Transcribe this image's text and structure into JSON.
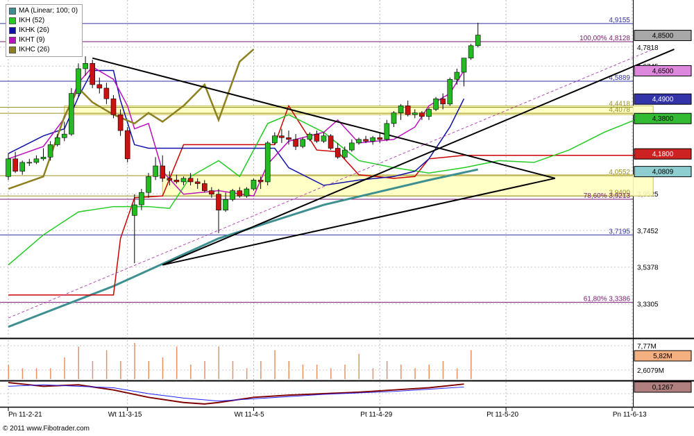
{
  "legend": [
    {
      "label": "MA (Linear; 100; 0)",
      "color": "#3d8f90"
    },
    {
      "label": "IKH (52)",
      "color": "#22cc22"
    },
    {
      "label": "IKHK (26)",
      "color": "#1010aa"
    },
    {
      "label": "IKHT (9)",
      "color": "#bb10bb"
    },
    {
      "label": "IKHC (26)",
      "color": "#8c8020"
    }
  ],
  "copyright": "© 2011 www.Fibotrader.com",
  "chart_data": [
    {
      "type": "candlestick",
      "title": "",
      "xlabel": "",
      "ylabel": "",
      "x_tick_labels": [
        "Pn 11-2-21",
        "Wt 11-3-15",
        "Wt 11-4-5",
        "Pt 11-4-29",
        "Pt 11-5-20",
        "Pn 11-6-13"
      ],
      "y_tick_labels": [
        "4,7818",
        "4,6745",
        "3,9525",
        "3,7452",
        "3,5378",
        "3,3305"
      ],
      "ylim": [
        3.14,
        4.97
      ],
      "grid": true,
      "candles": [
        [
          4.05,
          4.18,
          4.03,
          4.15
        ],
        [
          4.15,
          4.19,
          4.07,
          4.08
        ],
        [
          4.08,
          4.14,
          4.06,
          4.13
        ],
        [
          4.13,
          4.15,
          4.11,
          4.13
        ],
        [
          4.13,
          4.17,
          4.12,
          4.15
        ],
        [
          4.15,
          4.21,
          4.14,
          4.16
        ],
        [
          4.16,
          4.25,
          4.14,
          4.23
        ],
        [
          4.23,
          4.29,
          4.22,
          4.27
        ],
        [
          4.27,
          4.36,
          4.25,
          4.29
        ],
        [
          4.29,
          4.55,
          4.28,
          4.52
        ],
        [
          4.52,
          4.69,
          4.5,
          4.66
        ],
        [
          4.66,
          4.73,
          4.62,
          4.69
        ],
        [
          4.69,
          4.71,
          4.55,
          4.57
        ],
        [
          4.57,
          4.61,
          4.52,
          4.55
        ],
        [
          4.55,
          4.58,
          4.46,
          4.49
        ],
        [
          4.49,
          4.51,
          4.38,
          4.4
        ],
        [
          4.4,
          4.43,
          4.28,
          4.31
        ],
        [
          4.31,
          4.33,
          4.13,
          4.15
        ],
        [
          3.83,
          3.95,
          3.56,
          3.89
        ],
        [
          3.89,
          3.98,
          3.86,
          3.96
        ],
        [
          3.96,
          4.07,
          3.93,
          4.05
        ],
        [
          4.05,
          4.16,
          4.03,
          4.11
        ],
        [
          4.11,
          4.17,
          4.02,
          4.04
        ],
        [
          4.04,
          4.08,
          4.0,
          4.03
        ],
        [
          4.03,
          4.06,
          4.01,
          4.02
        ],
        [
          4.02,
          4.05,
          4.0,
          4.04
        ],
        [
          4.04,
          4.07,
          4.0,
          4.02
        ],
        [
          4.02,
          4.04,
          3.98,
          4.01
        ],
        [
          4.01,
          4.03,
          3.96,
          3.97
        ],
        [
          3.97,
          3.99,
          3.93,
          3.95
        ],
        [
          3.95,
          3.98,
          3.73,
          3.86
        ],
        [
          3.86,
          3.96,
          3.85,
          3.92
        ],
        [
          3.92,
          3.98,
          3.91,
          3.97
        ],
        [
          3.97,
          3.99,
          3.93,
          3.94
        ],
        [
          3.94,
          3.99,
          3.93,
          3.98
        ],
        [
          3.98,
          4.04,
          3.97,
          4.03
        ],
        [
          4.03,
          4.05,
          3.98,
          4.02
        ],
        [
          4.02,
          4.25,
          4.0,
          4.24
        ],
        [
          4.24,
          4.3,
          4.23,
          4.28
        ],
        [
          4.28,
          4.32,
          4.24,
          4.27
        ],
        [
          4.27,
          4.31,
          4.23,
          4.26
        ],
        [
          4.26,
          4.29,
          4.2,
          4.22
        ],
        [
          4.22,
          4.27,
          4.21,
          4.26
        ],
        [
          4.26,
          4.3,
          4.25,
          4.29
        ],
        [
          4.29,
          4.31,
          4.24,
          4.25
        ],
        [
          4.25,
          4.3,
          4.24,
          4.28
        ],
        [
          4.28,
          4.29,
          4.2,
          4.21
        ],
        [
          4.21,
          4.24,
          4.15,
          4.16
        ],
        [
          4.16,
          4.22,
          4.15,
          4.2
        ],
        [
          4.2,
          4.26,
          4.19,
          4.24
        ],
        [
          4.24,
          4.27,
          4.23,
          4.26
        ],
        [
          4.26,
          4.28,
          4.24,
          4.25
        ],
        [
          4.25,
          4.28,
          4.23,
          4.27
        ],
        [
          4.27,
          4.3,
          4.24,
          4.26
        ],
        [
          4.26,
          4.37,
          4.25,
          4.35
        ],
        [
          4.35,
          4.42,
          4.33,
          4.41
        ],
        [
          4.41,
          4.46,
          4.37,
          4.45
        ],
        [
          4.45,
          4.48,
          4.39,
          4.4
        ],
        [
          4.4,
          4.43,
          4.38,
          4.41
        ],
        [
          4.41,
          4.42,
          4.37,
          4.39
        ],
        [
          4.39,
          4.44,
          4.37,
          4.43
        ],
        [
          4.43,
          4.5,
          4.42,
          4.49
        ],
        [
          4.49,
          4.52,
          4.43,
          4.46
        ],
        [
          4.46,
          4.61,
          4.45,
          4.6
        ],
        [
          4.6,
          4.66,
          4.57,
          4.64
        ],
        [
          4.64,
          4.72,
          4.56,
          4.72
        ],
        [
          4.72,
          4.8,
          4.71,
          4.79
        ],
        [
          4.79,
          4.92,
          4.78,
          4.85
        ]
      ],
      "series": [
        {
          "name": "MA (Linear; 100; 0)",
          "color": "#3d8f90",
          "x": [
            0,
            15,
            30,
            45,
            60,
            67
          ],
          "y": [
            3.2,
            3.43,
            3.7,
            3.89,
            4.03,
            4.09
          ]
        },
        {
          "name": "IKH (52)",
          "color": "#22cc22",
          "x": [
            0,
            5,
            10,
            15,
            20,
            23,
            26,
            30,
            33,
            37,
            40,
            45,
            50,
            55,
            60,
            65,
            70,
            75,
            80,
            85,
            90
          ],
          "y": [
            3.55,
            3.72,
            3.85,
            3.88,
            3.88,
            3.87,
            4.05,
            4.14,
            4.05,
            4.35,
            4.4,
            4.3,
            4.14,
            4.1,
            4.07,
            4.1,
            4.14,
            4.13,
            4.2,
            4.3,
            4.38
          ]
        },
        {
          "name": "IKHK (26)",
          "color": "#1010aa",
          "x": [
            0,
            5,
            8,
            10,
            12,
            15,
            16,
            18,
            20,
            25,
            30,
            35,
            38,
            40,
            45,
            50,
            55,
            58,
            60,
            63,
            65
          ],
          "y": [
            4.18,
            4.28,
            4.32,
            4.5,
            4.65,
            4.65,
            4.48,
            4.23,
            4.21,
            4.21,
            4.21,
            4.21,
            4.21,
            4.1,
            4.0,
            4.03,
            4.05,
            4.08,
            4.15,
            4.33,
            4.49
          ]
        },
        {
          "name": "IKHT (9)",
          "color": "#bb10bb",
          "x": [
            0,
            5,
            8,
            10,
            12,
            15,
            17,
            18,
            20,
            22,
            25,
            30,
            35,
            37,
            40,
            45,
            47,
            50,
            55,
            58,
            60,
            63,
            65
          ],
          "y": [
            4.15,
            4.22,
            4.38,
            4.58,
            4.67,
            4.6,
            4.45,
            4.32,
            4.35,
            4.08,
            3.95,
            3.97,
            3.94,
            4.12,
            4.25,
            4.3,
            4.37,
            4.24,
            4.26,
            4.33,
            4.45,
            4.52,
            4.65
          ]
        },
        {
          "name": "IKHC (26)",
          "color": "#8c8020",
          "x": [
            0,
            5,
            8,
            10,
            12,
            15,
            18,
            20,
            22,
            25,
            28,
            30,
            33,
            35
          ],
          "y": [
            3.98,
            4.05,
            4.39,
            4.55,
            4.47,
            4.4,
            4.35,
            4.41,
            4.36,
            4.45,
            4.57,
            4.37,
            4.7,
            4.77
          ]
        },
        {
          "name": "",
          "color": "#cc0000",
          "x": [
            0,
            10,
            15,
            16,
            18,
            22,
            25,
            30,
            38,
            40,
            44,
            47,
            50,
            55,
            58,
            60,
            65,
            70,
            75,
            80,
            90
          ],
          "y": [
            3.38,
            3.38,
            3.38,
            3.7,
            3.93,
            3.94,
            4.23,
            4.23,
            4.23,
            4.45,
            4.2,
            4.19,
            4.06,
            4.04,
            4.05,
            4.15,
            4.17,
            4.17,
            4.17,
            4.17,
            4.17
          ]
        }
      ],
      "horizontal_lines": [
        {
          "value": 4.9155,
          "label": "4,9155",
          "color": "#3030a0"
        },
        {
          "value": 4.8128,
          "label": "100,00% 4,8128",
          "color": "#7a1870"
        },
        {
          "value": 4.5889,
          "label": "4,5889",
          "color": "#3030a0"
        },
        {
          "value": 4.4418,
          "label": "4,4418",
          "color": "#9a9020"
        },
        {
          "value": 4.4078,
          "label": "4,4078",
          "color": "#9a9020"
        },
        {
          "value": 4.0552,
          "label": "4,0552",
          "color": "#9a9020"
        },
        {
          "value": 3.94,
          "label": "3,9400",
          "color": "#9a9020"
        },
        {
          "value": 3.9213,
          "label": "78,60% 3,9213",
          "color": "#7a1870"
        },
        {
          "value": 3.7195,
          "label": "3,7195",
          "color": "#3030a0"
        },
        {
          "value": 3.3386,
          "label": "61,80% 3,3386",
          "color": "#7a1870"
        }
      ],
      "zones": [
        {
          "from_x": 8,
          "to_x": 92,
          "ymin": 4.4,
          "ymax": 4.45,
          "color": "#ffffc0"
        },
        {
          "from_x": 22,
          "to_x": 92,
          "ymin": 3.94,
          "ymax": 4.06,
          "color": "#ffffc0"
        }
      ],
      "trendlines": [
        {
          "x": [
            12,
            78
          ],
          "y": [
            4.72,
            4.04
          ],
          "color": "#000000"
        },
        {
          "x": [
            22,
            78
          ],
          "y": [
            3.55,
            4.04
          ],
          "color": "#000000"
        },
        {
          "x": [
            22,
            95
          ],
          "y": [
            3.55,
            4.77
          ],
          "color": "#000000"
        },
        {
          "x": [
            0,
            92
          ],
          "y": [
            3.25,
            4.77
          ],
          "color": "#aa22aa",
          "dashed": true
        }
      ],
      "badges": [
        {
          "label": "4,8500",
          "value": 4.85,
          "bg": "#a8a8a8"
        },
        {
          "label": "4,6500",
          "value": 4.65,
          "bg": "#dd88dd"
        },
        {
          "label": "4,4900",
          "value": 4.49,
          "bg": "#3333aa"
        },
        {
          "label": "4,3800",
          "value": 4.38,
          "bg": "#33bb33"
        },
        {
          "label": "4,1800",
          "value": 4.18,
          "bg": "#cc2222"
        },
        {
          "label": "4,0809",
          "value": 4.08,
          "bg": "#8ecdd0"
        }
      ]
    },
    {
      "type": "bar",
      "title": "",
      "y_tick_labels": [
        "7,77M",
        "2,6079M"
      ],
      "current_label": "5,82M",
      "current_bg": "#f4b080",
      "values": [
        0.4,
        0.0,
        0.3,
        0.0,
        0.3,
        0.0,
        0.3,
        0.0,
        0.6,
        0.0,
        0.9,
        0.0,
        0.5,
        0.0,
        0.8,
        0.0,
        0.5,
        0.0,
        1.0,
        0.0,
        0.5,
        0.0,
        0.6,
        0.0,
        0.9,
        0.0,
        0.4,
        0.0,
        0.5,
        0.0,
        0.9,
        0.0,
        0.5,
        0.0,
        0.3,
        0.0,
        0.5,
        0.0,
        0.8,
        0.0,
        0.5,
        0.0,
        0.4,
        0.0,
        0.4,
        0.0,
        0.3,
        0.0,
        0.4,
        0.0,
        0.7,
        0.0,
        0.3,
        0.0,
        0.5,
        0.0,
        0.4,
        0.0,
        0.3,
        0.0,
        0.4,
        0.0,
        0.5,
        0.0,
        0.3,
        0.0,
        0.8,
        0.0
      ]
    },
    {
      "type": "line",
      "title": "",
      "current_label": "0,1267",
      "current_bg": "#b08080",
      "series": [
        {
          "name": "",
          "color": "#800000",
          "x": [
            0,
            5,
            10,
            15,
            20,
            25,
            28,
            30,
            35,
            40,
            45,
            50,
            55,
            60,
            65
          ],
          "y": [
            0.15,
            0.1,
            0.12,
            0.05,
            -0.05,
            -0.12,
            -0.14,
            -0.12,
            -0.05,
            -0.02,
            0.0,
            0.02,
            0.05,
            0.08,
            0.13
          ]
        },
        {
          "name": "",
          "color": "#2020ff",
          "x": [
            0,
            5,
            10,
            15,
            20,
            25,
            30,
            35,
            40,
            45,
            50,
            55,
            60,
            65
          ],
          "y": [
            0.1,
            0.12,
            0.1,
            0.08,
            0.0,
            -0.06,
            -0.1,
            -0.07,
            -0.04,
            -0.01,
            0.01,
            0.03,
            0.06,
            0.09
          ]
        }
      ]
    }
  ]
}
